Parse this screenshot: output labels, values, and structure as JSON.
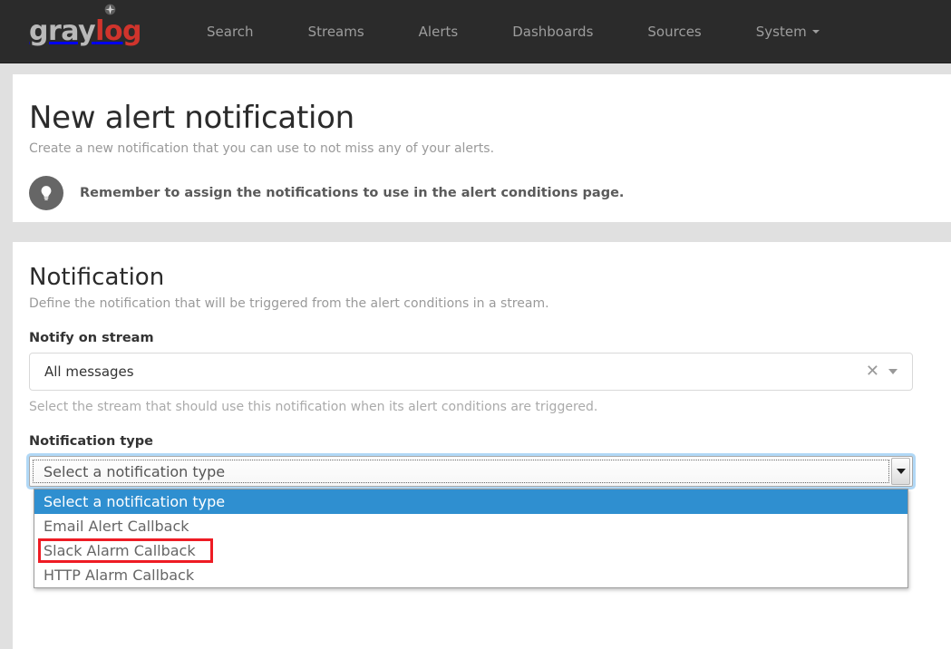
{
  "navbar": {
    "brand": {
      "part1": "gray",
      "part2": "log",
      "icon": "compass-dot-icon"
    },
    "links": [
      {
        "label": "Search",
        "name": "nav-link-search"
      },
      {
        "label": "Streams",
        "name": "nav-link-streams"
      },
      {
        "label": "Alerts",
        "name": "nav-link-alerts"
      },
      {
        "label": "Dashboards",
        "name": "nav-link-dashboards"
      },
      {
        "label": "Sources",
        "name": "nav-link-sources"
      },
      {
        "label": "System",
        "name": "nav-link-system",
        "has_caret": true
      }
    ]
  },
  "header": {
    "title": "New alert notification",
    "subtitle": "Create a new notification that you can use to not miss any of your alerts.",
    "tip": "Remember to assign the notifications to use in the alert conditions page.",
    "tip_icon": "lightbulb-icon"
  },
  "notification_section": {
    "title": "Notification",
    "subtitle": "Define the notification that will be triggered from the alert conditions in a stream.",
    "stream_field": {
      "label": "Notify on stream",
      "value": "All messages",
      "clear_icon": "close-x-icon",
      "caret_icon": "chevron-down-icon",
      "help": "Select the stream that should use this notification when its alert conditions are triggered."
    },
    "type_field": {
      "label": "Notification type",
      "value": "Select a notification type",
      "arrow_icon": "triangle-down-icon",
      "options": [
        {
          "label": "Select a notification type",
          "selected": true,
          "annotated": false
        },
        {
          "label": "Email Alert Callback",
          "selected": false,
          "annotated": false
        },
        {
          "label": "Slack Alarm Callback",
          "selected": false,
          "annotated": true
        },
        {
          "label": "HTTP Alarm Callback",
          "selected": false,
          "annotated": false
        }
      ]
    }
  },
  "colors": {
    "navbar_bg": "#2b2b2b",
    "brand_red": "#d0342c",
    "page_bg": "#e0e0e0",
    "option_highlight": "#2f8fd0",
    "annotation_red": "#ee1c24",
    "focus_glow": "#52a8ec"
  }
}
